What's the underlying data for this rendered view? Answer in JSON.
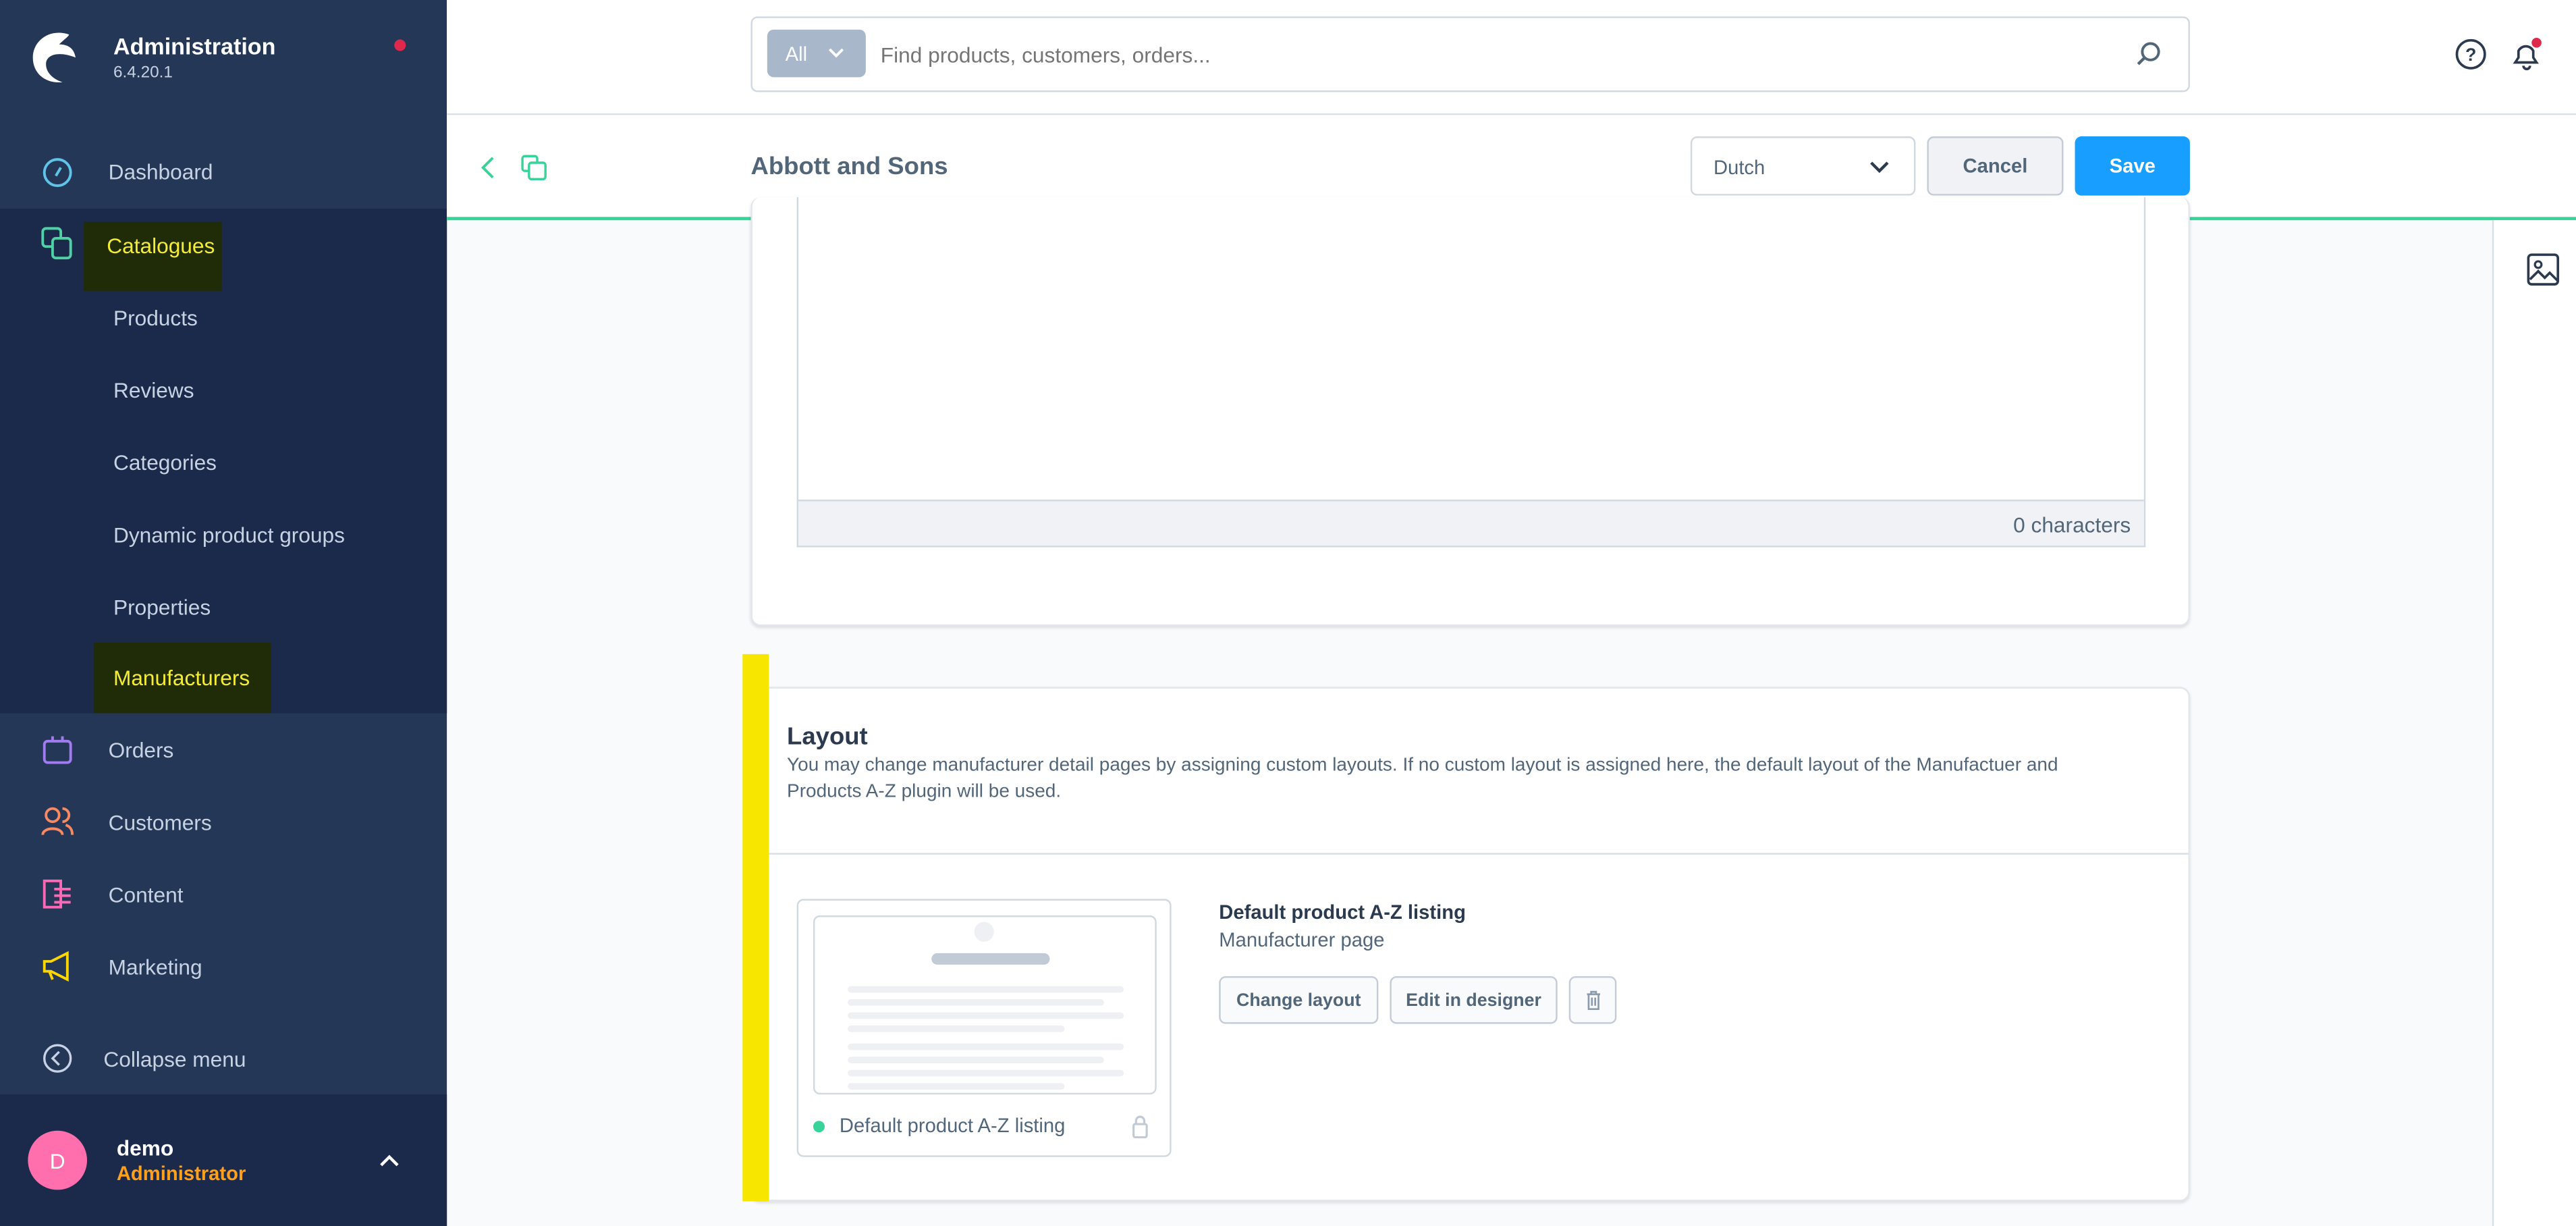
{
  "app": {
    "title": "Administration",
    "version": "6.4.20.1"
  },
  "sidebar": {
    "items": [
      {
        "label": "Dashboard",
        "icon": "gauge-icon"
      },
      {
        "label": "Catalogues",
        "icon": "catalogue-icon"
      },
      {
        "label": "Orders",
        "icon": "bag-icon"
      },
      {
        "label": "Customers",
        "icon": "users-icon"
      },
      {
        "label": "Content",
        "icon": "content-icon"
      },
      {
        "label": "Marketing",
        "icon": "megaphone-icon"
      }
    ],
    "sub_items": [
      "Products",
      "Reviews",
      "Categories",
      "Dynamic product groups",
      "Properties",
      "Manufacturers"
    ],
    "collapse": "Collapse menu",
    "user": {
      "initial": "D",
      "name": "demo",
      "role": "Administrator"
    }
  },
  "search": {
    "filter": "All",
    "placeholder": "Find products, customers, orders..."
  },
  "smartbar": {
    "title": "Abbott and Sons",
    "language": "Dutch",
    "cancel": "Cancel",
    "save": "Save"
  },
  "editor": {
    "char_count": "0 characters"
  },
  "layout": {
    "title": "Layout",
    "description": "You may change manufacturer detail pages by assigning custom layouts. If no custom layout is assigned here, the default layout of the Manufactuer and Products A-Z plugin will be used.",
    "preview_name": "Default product A-Z listing",
    "name": "Default product A-Z listing",
    "type": "Manufacturer page",
    "change": "Change layout",
    "edit": "Edit in designer"
  },
  "colors": {
    "accent": "#189eff",
    "sidebar": "#243757",
    "highlight": "#f5ec35",
    "green": "#37d399"
  }
}
